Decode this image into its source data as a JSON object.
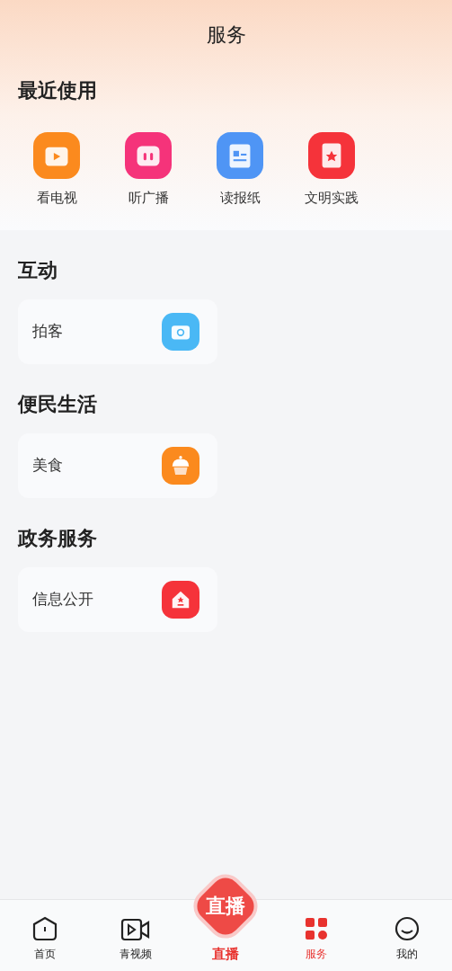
{
  "header": {
    "title": "服务"
  },
  "recent": {
    "title": "最近使用",
    "items": [
      {
        "label": "看电视",
        "kind": "tv",
        "color": "#fb8a1e"
      },
      {
        "label": "听广播",
        "kind": "radio",
        "color": "#f5337a"
      },
      {
        "label": "读报纸",
        "kind": "paper",
        "color": "#4f95f5"
      },
      {
        "label": "文明实践",
        "kind": "practice",
        "color": "#f5333a"
      }
    ]
  },
  "sections": [
    {
      "title": "互动",
      "items": [
        {
          "label": "拍客",
          "kind": "camera",
          "color": "#4ab8f5"
        }
      ]
    },
    {
      "title": "便民生活",
      "items": [
        {
          "label": "美食",
          "kind": "food",
          "color": "#fb8a1e"
        }
      ]
    },
    {
      "title": "政务服务",
      "items": [
        {
          "label": "信息公开",
          "kind": "gov",
          "color": "#f5333a"
        }
      ]
    }
  ],
  "tabbar": [
    {
      "label": "首页",
      "kind": "home",
      "selected": false
    },
    {
      "label": "青视频",
      "kind": "video",
      "selected": false
    },
    {
      "label": "直播",
      "badge": "直播",
      "kind": "live",
      "selected": false
    },
    {
      "label": "服务",
      "kind": "service",
      "selected": true
    },
    {
      "label": "我的",
      "kind": "me",
      "selected": false
    }
  ]
}
